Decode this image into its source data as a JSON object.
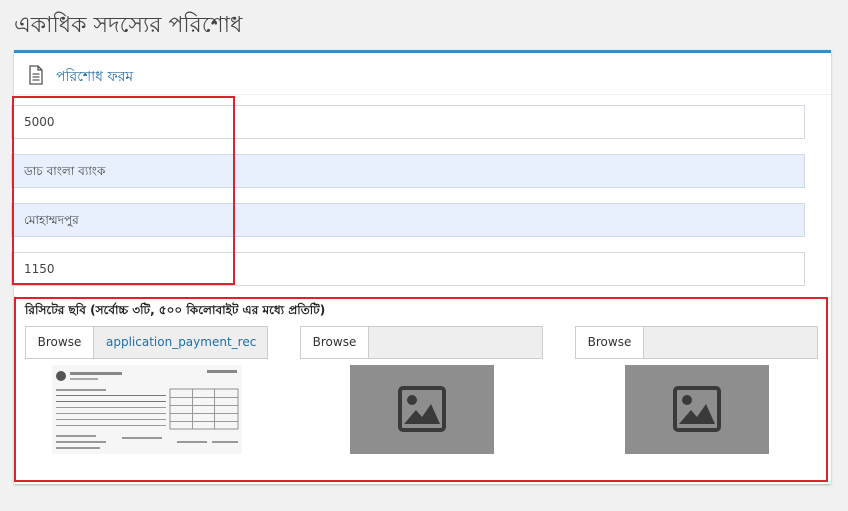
{
  "page": {
    "title": "একাধিক সদস্যের পরিশোধ"
  },
  "form": {
    "title": "পরিশোধ ফরম",
    "icon": "document-icon",
    "fields": [
      {
        "value": "5000"
      },
      {
        "value": "ডাচ বাংলা ব্যাংক"
      },
      {
        "value": "মোহাম্মদপুর"
      },
      {
        "value": "1150"
      }
    ]
  },
  "upload": {
    "label": "রিসিটের ছবি (সর্বোচ্চ ৩টি, ৫০০ কিলোবাইট এর মধ্যে প্রতিটি)",
    "slots": [
      {
        "button": "Browse",
        "filename": "application_payment_rec"
      },
      {
        "button": "Browse",
        "filename": ""
      },
      {
        "button": "Browse",
        "filename": ""
      }
    ],
    "preview_icons": [
      "receipt-image",
      "image-placeholder-icon",
      "image-placeholder-icon"
    ]
  },
  "colors": {
    "accent": "#3c8dbc",
    "highlight": "#d9232d",
    "filled_bg": "#e8f0fe"
  }
}
